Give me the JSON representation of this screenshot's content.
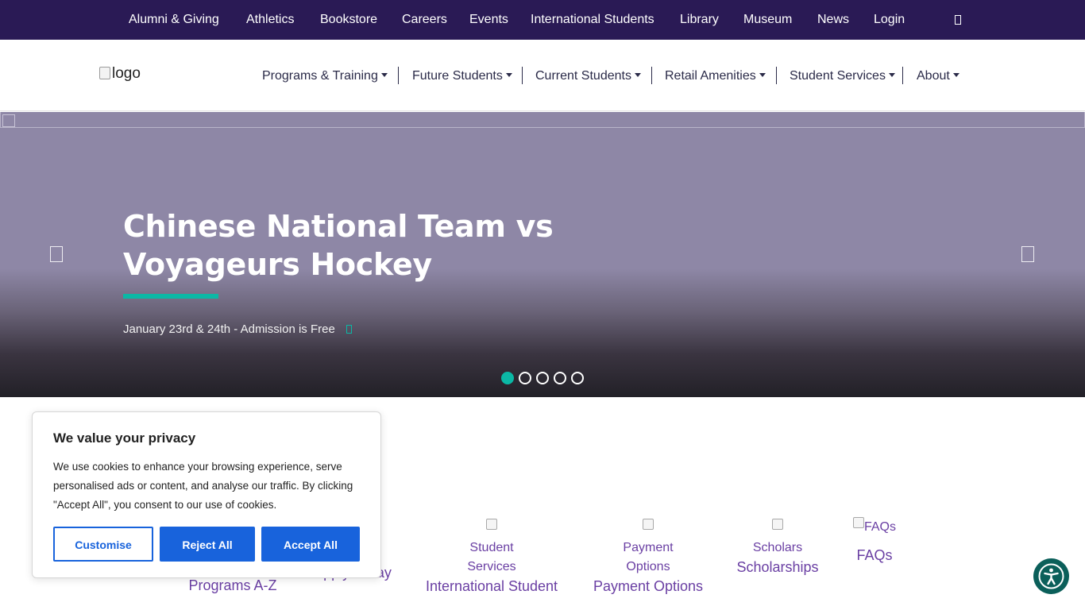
{
  "topbar": {
    "links": [
      "Alumni & Giving",
      "Athletics",
      "Bookstore",
      "Careers",
      "Events",
      "International Students",
      "Library",
      "Museum",
      "News",
      "Login"
    ],
    "search_icon": "search-icon"
  },
  "header": {
    "logo_alt": "logo",
    "nav": [
      "Programs & Training",
      "Future Students",
      "Current Students",
      "Retail Amenities",
      "Student Services",
      "About"
    ]
  },
  "hero": {
    "title": "Chinese National Team vs Voyageurs Hockey",
    "subtitle": "January 23rd & 24th - Admission is Free",
    "slide_count": 5,
    "active_slide": 1,
    "accent_color": "#0bb8a5"
  },
  "quick_links": {
    "items": [
      {
        "alt": "",
        "label": "Programs A-Z"
      },
      {
        "alt": "",
        "label": "Apply Today"
      },
      {
        "alt": "Student Services",
        "label": "International Student"
      },
      {
        "alt": "Payment Options",
        "label": "Payment Options"
      },
      {
        "alt": "Scholars",
        "label": "Scholarships"
      },
      {
        "alt": "FAQs",
        "label": "FAQs"
      }
    ]
  },
  "cookie": {
    "title": "We value your privacy",
    "text": "We use cookies to enhance your browsing experience, serve personalised ads or content, and analyse our traffic. By clicking \"Accept All\", you consent to our use of cookies.",
    "customise": "Customise",
    "reject": "Reject All",
    "accept": "Accept All",
    "button_color": "#1863dc"
  },
  "accessibility": {
    "icon": "accessibility-icon"
  }
}
